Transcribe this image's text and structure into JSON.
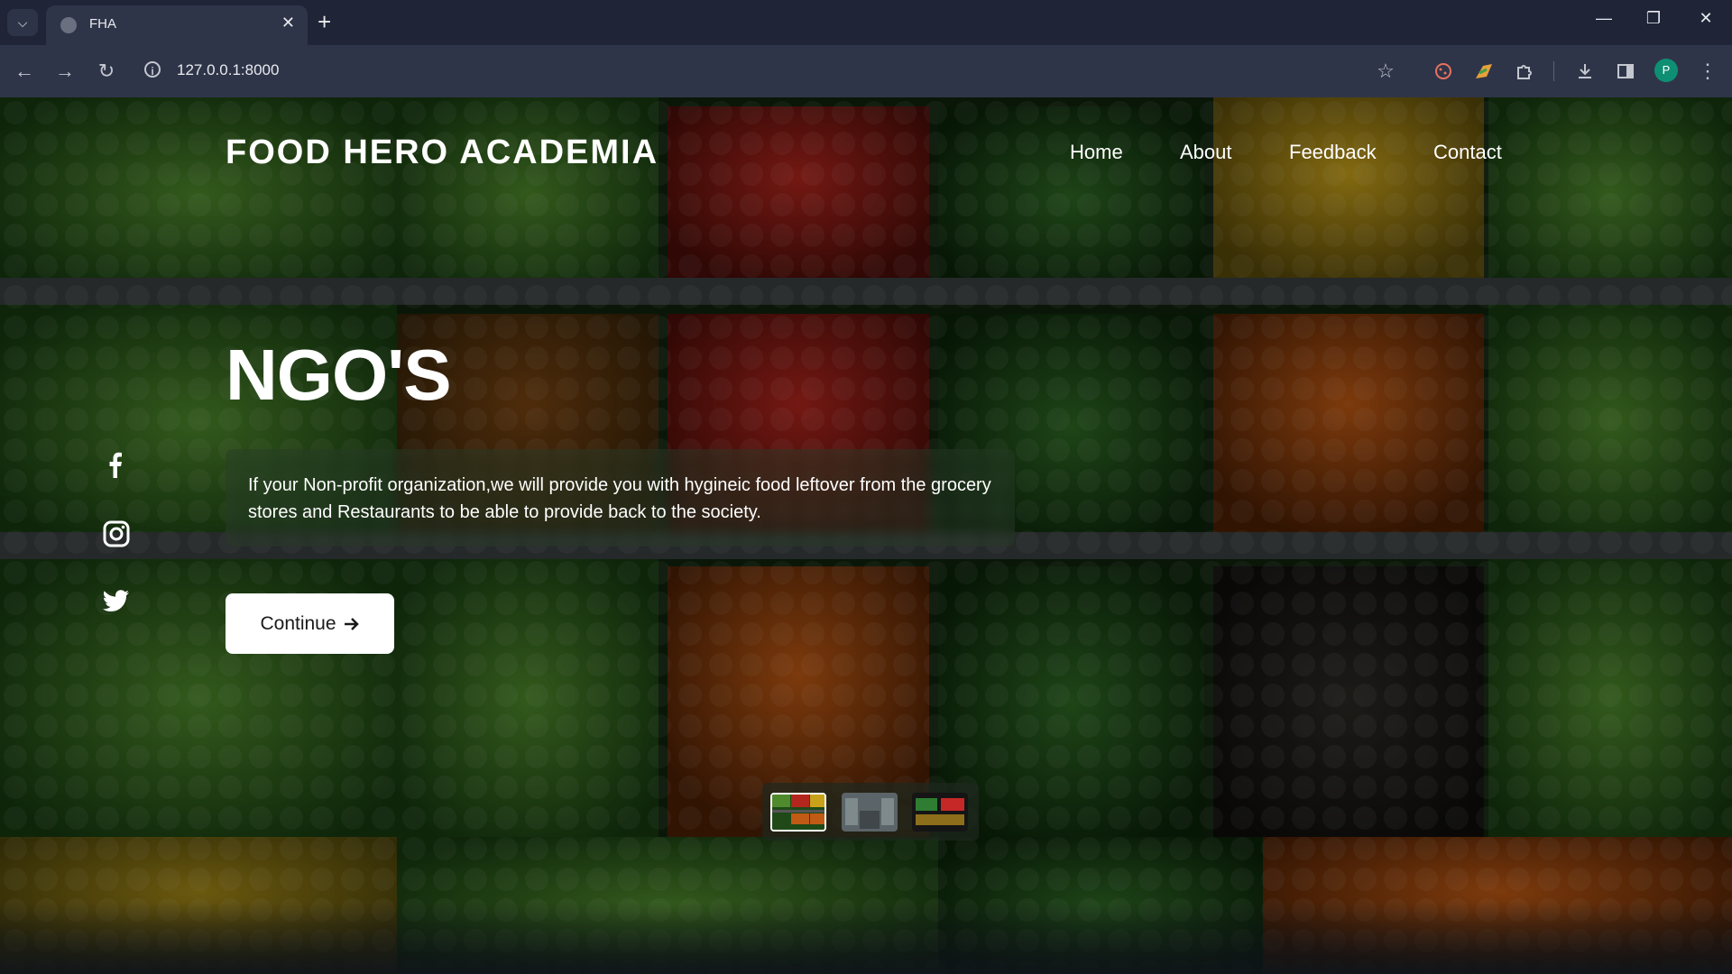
{
  "browser": {
    "tab_title": "FHA",
    "url": "127.0.0.1:8000",
    "avatar_initial": "P"
  },
  "site": {
    "brand": "FOOD HERO ACADEMIA",
    "nav": [
      "Home",
      "About",
      "Feedback",
      "Contact"
    ],
    "headline": "NGO'S",
    "description": "If your Non-profit organization,we will provide you with hygineic food leftover from the grocery stores and Restaurants to be able to provide back to the society.",
    "cta_label": "Continue",
    "social_icons": [
      "facebook-icon",
      "instagram-icon",
      "twitter-icon"
    ],
    "slider": {
      "slide_count": 3,
      "active_slide": 1
    }
  },
  "colors": {
    "chrome_bg": "#1f2437",
    "toolbar_bg": "#2f3549",
    "overlay": "rgba(0,0,0,0.35)",
    "button_bg": "#ffffff"
  }
}
